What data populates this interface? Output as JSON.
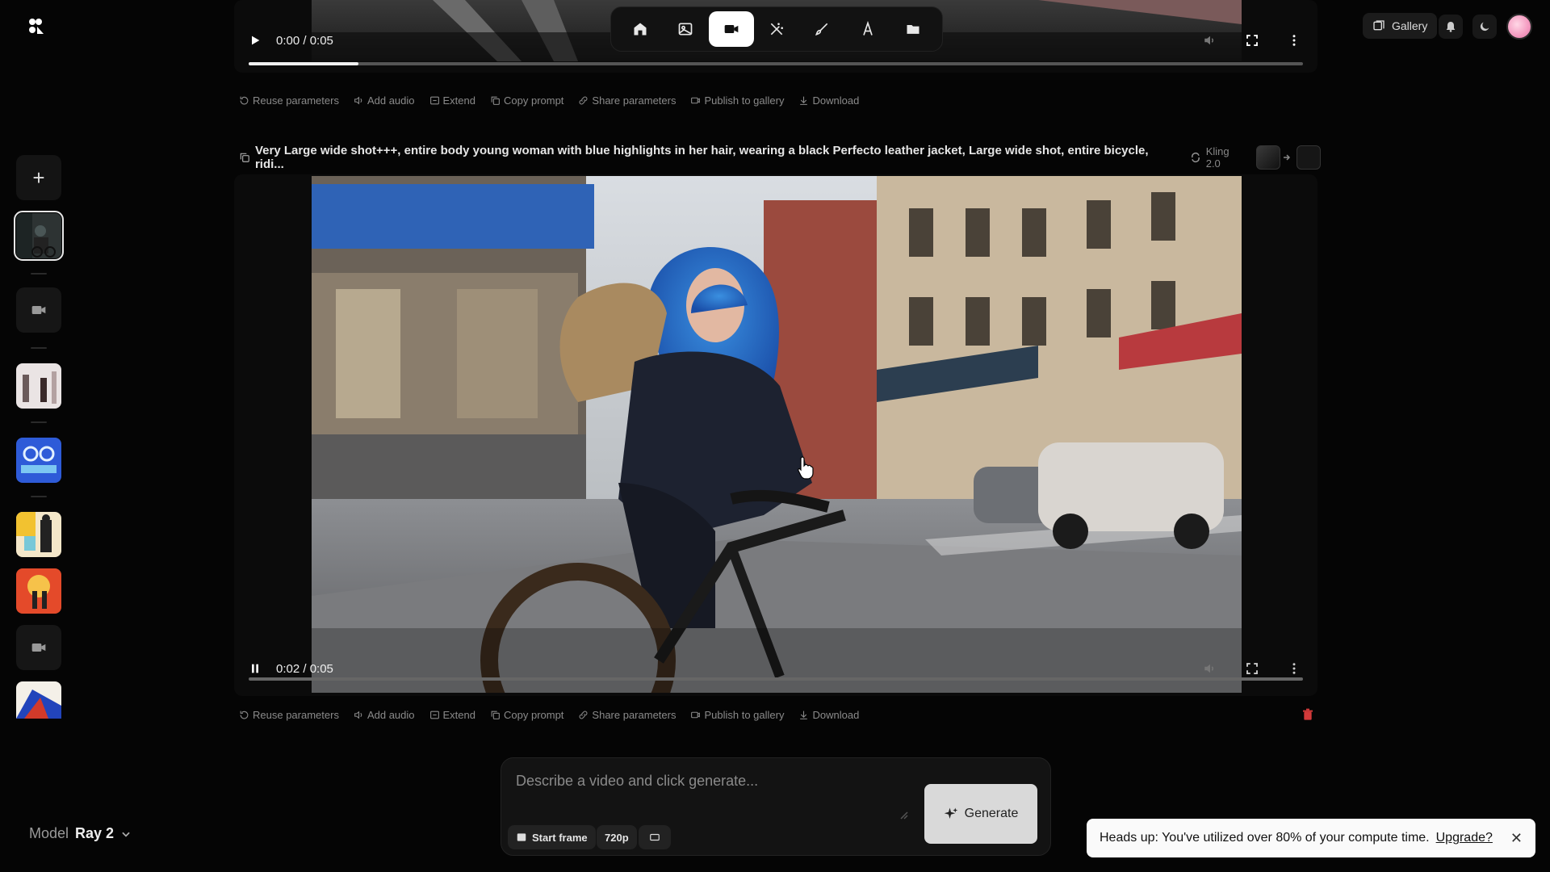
{
  "nav": {
    "items": [
      {
        "icon": "home-icon"
      },
      {
        "icon": "image-icon"
      },
      {
        "icon": "video-camera-icon",
        "active": true
      },
      {
        "icon": "magic-wand-icon"
      },
      {
        "icon": "brush-icon"
      },
      {
        "icon": "text-icon"
      },
      {
        "icon": "folder-icon"
      }
    ]
  },
  "header": {
    "gallery_label": "Gallery"
  },
  "video1": {
    "time": "0:00 / 0:05",
    "progress": 0.104
  },
  "video2": {
    "prompt": "Very Large wide shot+++, entire body young woman with blue highlights in her hair, wearing a black Perfecto leather jacket, Large wide shot, entire bicycle, ridi...",
    "model": "Kling 2.0",
    "time": "0:02 / 0:05",
    "progress": 0.0
  },
  "actions": {
    "reuse": "Reuse parameters",
    "add_audio": "Add audio",
    "extend": "Extend",
    "copy_prompt": "Copy prompt",
    "share": "Share parameters",
    "publish": "Publish to gallery",
    "download": "Download"
  },
  "promptbar": {
    "placeholder": "Describe a video and click generate...",
    "start_frame": "Start frame",
    "resolution": "720p",
    "generate": "Generate"
  },
  "model_selector": {
    "label": "Model",
    "value": "Ray 2"
  },
  "toast": {
    "message": "Heads up: You've utilized over 80% of your compute time.",
    "link": "Upgrade?",
    "close": "✕"
  },
  "colors": {
    "background": "#050505",
    "accent": "#ffffff",
    "danger": "#d23a3a"
  }
}
